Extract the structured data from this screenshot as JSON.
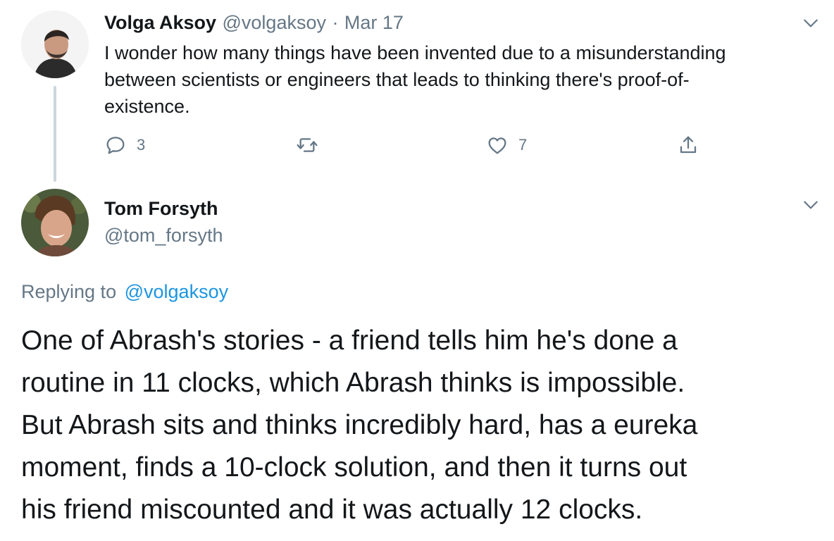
{
  "original_tweet": {
    "author_name": "Volga Aksoy",
    "author_handle": "@volgaksoy",
    "separator": "·",
    "date": "Mar 17",
    "text_lines": [
      "I wonder how many things have been invented due to a misunderstanding",
      "between scientists or engineers that leads to thinking there's proof-of-",
      "existence."
    ],
    "actions": {
      "reply_count": "3",
      "retweet_count": "",
      "like_count": "7"
    }
  },
  "reply_tweet": {
    "author_name": "Tom Forsyth",
    "author_handle": "@tom_forsyth",
    "replying_prefix": "Replying to",
    "replying_handle": "@volgaksoy",
    "text_lines": [
      "One of Abrash's stories - a friend tells him he's done a",
      "routine in 11 clocks, which Abrash thinks is impossible.",
      "But Abrash sits and thinks incredibly hard, has a eureka",
      "moment, finds a 10-clock solution, and then it turns out",
      "his friend miscounted and it was actually 12 clocks."
    ]
  },
  "colors": {
    "text": "#14171a",
    "secondary": "#657786",
    "link": "#1b95e0",
    "thread_line": "#ccd6dd"
  }
}
